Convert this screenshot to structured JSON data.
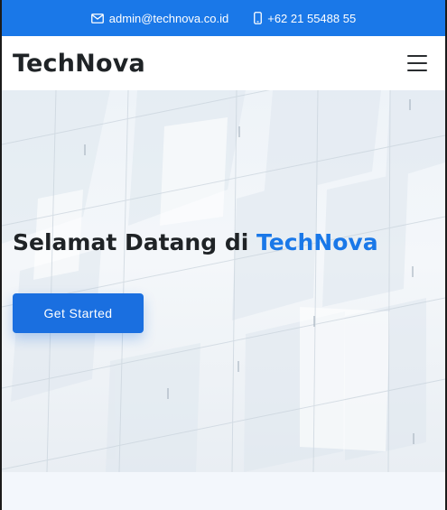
{
  "topbar": {
    "email_icon": "envelope-icon",
    "email": "admin@technova.co.id",
    "phone_icon": "phone-icon",
    "phone": "+62 21 55488 55"
  },
  "header": {
    "logo": "TechNova",
    "menu_icon": "hamburger-menu-icon"
  },
  "hero": {
    "title_prefix": "Selamat Datang di",
    "title_accent": "TechNova",
    "cta_label": "Get Started"
  },
  "colors": {
    "brand_blue": "#1a78e8",
    "heading": "#1f2326",
    "page_bg": "#f3f7fc"
  }
}
